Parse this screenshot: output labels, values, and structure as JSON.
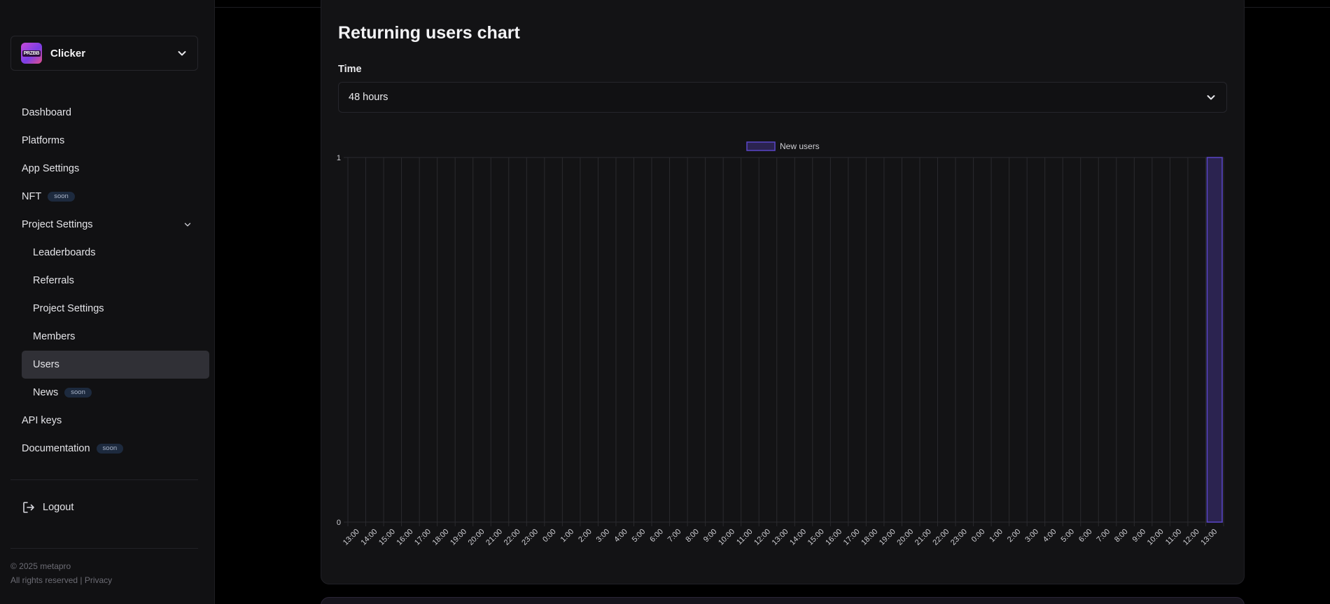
{
  "app": {
    "name": "Clicker",
    "logo_text": "PRZBB"
  },
  "sidebar": {
    "items": [
      {
        "label": "Dashboard"
      },
      {
        "label": "Platforms"
      },
      {
        "label": "App Settings"
      },
      {
        "label": "NFT",
        "badge": "soon"
      },
      {
        "label": "Project Settings"
      },
      {
        "label": "Leaderboards"
      },
      {
        "label": "Referrals"
      },
      {
        "label": "Project Settings"
      },
      {
        "label": "Members"
      },
      {
        "label": "Users"
      },
      {
        "label": "News",
        "badge": "soon"
      },
      {
        "label": "API keys"
      },
      {
        "label": "Documentation",
        "badge": "soon"
      }
    ],
    "logout": "Logout",
    "footer": {
      "copyright": "© 2025 metapro",
      "rights": "All rights reserved |",
      "privacy": "Privacy"
    }
  },
  "main": {
    "title": "Returning users chart",
    "time_label": "Time",
    "time_value": "48 hours"
  },
  "colors": {
    "bar_fill": "#2b2350",
    "bar_stroke": "#5a46c8",
    "grid": "#2a2a2e"
  },
  "chart_data": {
    "type": "bar",
    "legend": [
      "New users"
    ],
    "legend_position": "top-center",
    "grid": true,
    "ylim": [
      0,
      1
    ],
    "y_ticks": [
      "0",
      "1"
    ],
    "categories": [
      "13:00",
      "14:00",
      "15:00",
      "16:00",
      "17:00",
      "18:00",
      "19:00",
      "20:00",
      "21:00",
      "22:00",
      "23:00",
      "0:00",
      "1:00",
      "2:00",
      "3:00",
      "4:00",
      "5:00",
      "6:00",
      "7:00",
      "8:00",
      "9:00",
      "10:00",
      "11:00",
      "12:00",
      "13:00",
      "14:00",
      "15:00",
      "16:00",
      "17:00",
      "18:00",
      "19:00",
      "20:00",
      "21:00",
      "22:00",
      "23:00",
      "0:00",
      "1:00",
      "2:00",
      "3:00",
      "4:00",
      "5:00",
      "6:00",
      "7:00",
      "8:00",
      "9:00",
      "10:00",
      "11:00",
      "12:00",
      "13:00"
    ],
    "series": [
      {
        "name": "New users",
        "values": [
          0,
          0,
          0,
          0,
          0,
          0,
          0,
          0,
          0,
          0,
          0,
          0,
          0,
          0,
          0,
          0,
          0,
          0,
          0,
          0,
          0,
          0,
          0,
          0,
          0,
          0,
          0,
          0,
          0,
          0,
          0,
          0,
          0,
          0,
          0,
          0,
          0,
          0,
          0,
          0,
          0,
          0,
          0,
          0,
          0,
          0,
          0,
          0,
          1
        ]
      }
    ]
  }
}
